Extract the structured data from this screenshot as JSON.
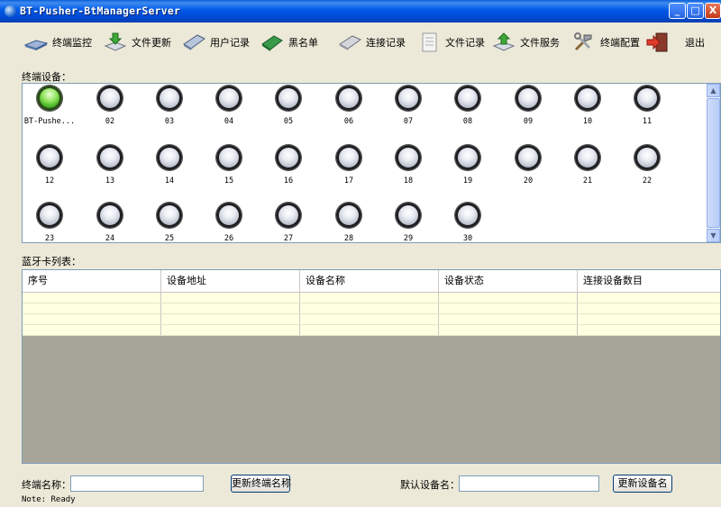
{
  "window": {
    "title": "BT-Pusher-BtManagerServer",
    "minimize": "_",
    "maximize": "□",
    "close": "X"
  },
  "toolbar": [
    {
      "label": "终端监控",
      "icon": "terminal-monitor-icon"
    },
    {
      "label": "文件更新",
      "icon": "file-update-icon"
    },
    {
      "label": "用户记录",
      "icon": "user-record-icon"
    },
    {
      "label": "黑名单",
      "icon": "blacklist-icon"
    },
    {
      "label": "连接记录",
      "icon": "connection-record-icon"
    },
    {
      "label": "文件记录",
      "icon": "file-record-icon"
    },
    {
      "label": "文件服务",
      "icon": "file-service-icon"
    },
    {
      "label": "终端配置",
      "icon": "terminal-config-icon"
    },
    {
      "label": "退出",
      "icon": "exit-icon"
    }
  ],
  "devices_label": "终端设备：",
  "devices": [
    {
      "label": "BT-Pushe...",
      "status": "on"
    },
    {
      "label": "02",
      "status": "off"
    },
    {
      "label": "03",
      "status": "off"
    },
    {
      "label": "04",
      "status": "off"
    },
    {
      "label": "05",
      "status": "off"
    },
    {
      "label": "06",
      "status": "off"
    },
    {
      "label": "07",
      "status": "off"
    },
    {
      "label": "08",
      "status": "off"
    },
    {
      "label": "09",
      "status": "off"
    },
    {
      "label": "10",
      "status": "off"
    },
    {
      "label": "11",
      "status": "off"
    },
    {
      "label": "12",
      "status": "off"
    },
    {
      "label": "13",
      "status": "off"
    },
    {
      "label": "14",
      "status": "off"
    },
    {
      "label": "15",
      "status": "off"
    },
    {
      "label": "16",
      "status": "off"
    },
    {
      "label": "17",
      "status": "off"
    },
    {
      "label": "18",
      "status": "off"
    },
    {
      "label": "19",
      "status": "off"
    },
    {
      "label": "20",
      "status": "off"
    },
    {
      "label": "21",
      "status": "off"
    },
    {
      "label": "22",
      "status": "off"
    },
    {
      "label": "23",
      "status": "off"
    },
    {
      "label": "24",
      "status": "off"
    },
    {
      "label": "25",
      "status": "off"
    },
    {
      "label": "26",
      "status": "off"
    },
    {
      "label": "27",
      "status": "off"
    },
    {
      "label": "28",
      "status": "off"
    },
    {
      "label": "29",
      "status": "off"
    },
    {
      "label": "30",
      "status": "off"
    }
  ],
  "bt_list_label": "蓝牙卡列表：",
  "table": {
    "columns": [
      "序号",
      "设备地址",
      "设备名称",
      "设备状态",
      "连接设备数目"
    ],
    "rows": [
      [
        "",
        "",
        "",
        "",
        ""
      ],
      [
        "",
        "",
        "",
        "",
        ""
      ],
      [
        "",
        "",
        "",
        "",
        ""
      ],
      [
        "",
        "",
        "",
        "",
        ""
      ]
    ]
  },
  "bottom": {
    "terminal_name_label": "终端名称：",
    "terminal_name_value": "",
    "update_terminal_button": "更新终端名称",
    "default_device_label": "默认设备名：",
    "default_device_value": "",
    "update_device_button": "更新设备名"
  },
  "status": "Note: Ready"
}
